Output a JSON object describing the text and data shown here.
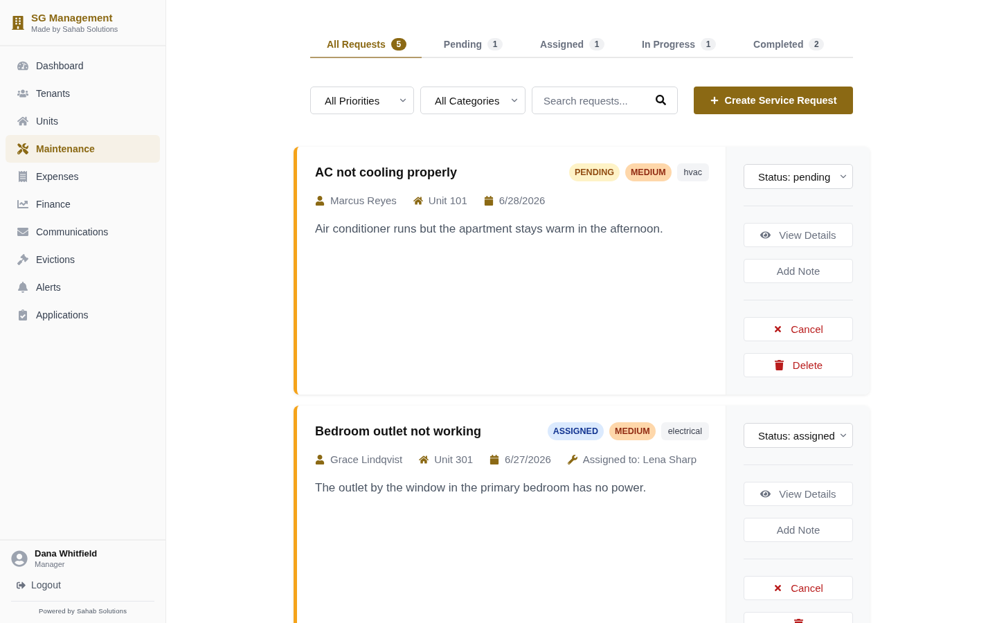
{
  "sidebar": {
    "brand": {
      "title": "SG Management",
      "subtitle": "Made by Sahab Solutions"
    },
    "nav": [
      {
        "label": "Dashboard",
        "selected": false
      },
      {
        "label": "Tenants",
        "selected": false
      },
      {
        "label": "Units",
        "selected": false
      },
      {
        "label": "Maintenance",
        "selected": true
      },
      {
        "label": "Expenses",
        "selected": false
      },
      {
        "label": "Finance",
        "selected": false
      },
      {
        "label": "Communications",
        "selected": false
      },
      {
        "label": "Evictions",
        "selected": false
      },
      {
        "label": "Alerts",
        "selected": false
      },
      {
        "label": "Applications",
        "selected": false
      }
    ],
    "user": {
      "name": "Dana Whitfield",
      "role": "Manager"
    },
    "logout": "Logout",
    "footer": "Powered by Sahab Solutions"
  },
  "tabs": [
    {
      "label": "All Requests",
      "count": "5",
      "selected": true
    },
    {
      "label": "Pending",
      "count": "1",
      "selected": false
    },
    {
      "label": "Assigned",
      "count": "1",
      "selected": false
    },
    {
      "label": "In Progress",
      "count": "1",
      "selected": false
    },
    {
      "label": "Completed",
      "count": "2",
      "selected": false
    }
  ],
  "filters": {
    "priority": "All Priorities",
    "category": "All Categories",
    "search": {
      "placeholder": "Search requests..."
    },
    "create_button": "Create Service Request"
  },
  "requests": [
    {
      "title": "AC not cooling properly",
      "badges": [
        {
          "kind": "status",
          "label": "PENDING",
          "color": "#fef3c7"
        },
        {
          "kind": "priority",
          "label": "MEDIUM",
          "color": "#fed7aa"
        },
        {
          "kind": "category",
          "label": "hvac",
          "color": "#f3f4f6"
        }
      ],
      "meta": [
        {
          "kind": "tenant",
          "text": "Marcus Reyes"
        },
        {
          "kind": "unit",
          "text": "Unit 101"
        },
        {
          "kind": "date",
          "text": "6/28/2026"
        }
      ],
      "description": "Air conditioner runs but the apartment stays warm in the afternoon.",
      "status_select": "Status: pending",
      "action_groups": [
        [
          {
            "kind": "view",
            "label": "View Details"
          },
          {
            "kind": "note",
            "label": "Add Note"
          }
        ],
        [
          {
            "kind": "cancel",
            "label": "Cancel"
          },
          {
            "kind": "delete",
            "label": "Delete"
          }
        ]
      ]
    },
    {
      "title": "Bedroom outlet not working",
      "badges": [
        {
          "kind": "status",
          "label": "ASSIGNED",
          "color": "#dbeafe"
        },
        {
          "kind": "priority",
          "label": "MEDIUM",
          "color": "#fed7aa"
        },
        {
          "kind": "category",
          "label": "electrical",
          "color": "#f3f4f6"
        }
      ],
      "meta": [
        {
          "kind": "tenant",
          "text": "Grace Lindqvist"
        },
        {
          "kind": "unit",
          "text": "Unit 301"
        },
        {
          "kind": "date",
          "text": "6/27/2026"
        },
        {
          "kind": "assignee",
          "text": "Assigned to: Lena Sharp"
        }
      ],
      "description": "The outlet by the window in the primary bedroom has no power.",
      "status_select": "Status: assigned",
      "action_groups": [
        [
          {
            "kind": "view",
            "label": "View Details"
          },
          {
            "kind": "note",
            "label": "Add Note"
          }
        ],
        [
          {
            "kind": "cancel",
            "label": "Cancel"
          },
          {
            "kind": "delete"
          }
        ]
      ]
    }
  ]
}
